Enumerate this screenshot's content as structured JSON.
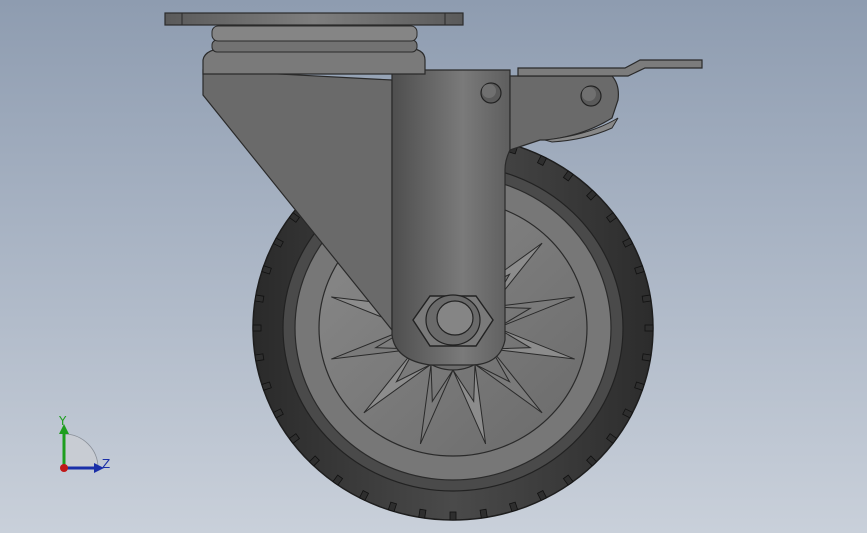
{
  "viewport": {
    "background_top": "#8e9cb0",
    "background_bottom": "#c9d0da"
  },
  "model": {
    "name": "caster-wheel-with-brake",
    "body_color": "#6e6e6e",
    "tire_color": "#3c3c3c",
    "hub_color": "#808080"
  },
  "triad": {
    "y_label": "Y",
    "z_label": "Z",
    "y_color": "#1e9e1e",
    "z_color": "#1a2fa8",
    "x_color": "#c01818"
  }
}
